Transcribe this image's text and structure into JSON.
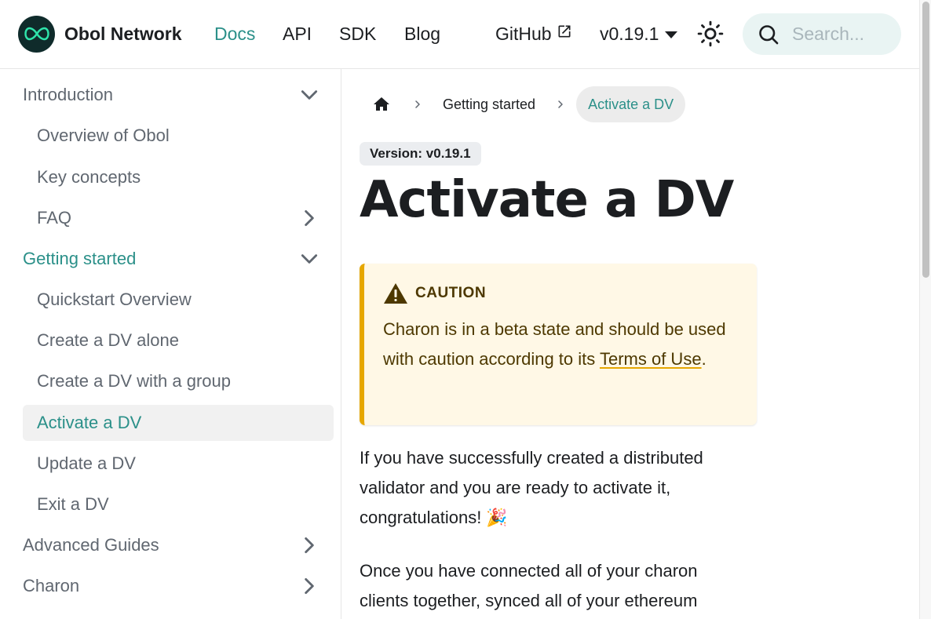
{
  "navbar": {
    "brand": "Obol Network",
    "links": {
      "docs": "Docs",
      "api": "API",
      "sdk": "SDK",
      "blog": "Blog",
      "github": "GitHub"
    },
    "version": "v0.19.1",
    "search_placeholder": "Search...",
    "accent_color": "#2b9089"
  },
  "sidebar": {
    "items": [
      {
        "label": "Introduction",
        "level": 0,
        "state": "expanded"
      },
      {
        "label": "Overview of Obol",
        "level": 1
      },
      {
        "label": "Key concepts",
        "level": 1
      },
      {
        "label": "FAQ",
        "level": 1,
        "state": "collapsed"
      },
      {
        "label": "Getting started",
        "level": 0,
        "state": "expanded",
        "active": true
      },
      {
        "label": "Quickstart Overview",
        "level": 1
      },
      {
        "label": "Create a DV alone",
        "level": 1
      },
      {
        "label": "Create a DV with a group",
        "level": 1
      },
      {
        "label": "Activate a DV",
        "level": 1,
        "current": true
      },
      {
        "label": "Update a DV",
        "level": 1
      },
      {
        "label": "Exit a DV",
        "level": 1
      },
      {
        "label": "Advanced Guides",
        "level": 0,
        "state": "collapsed"
      },
      {
        "label": "Charon",
        "level": 0,
        "state": "collapsed"
      }
    ]
  },
  "breadcrumbs": {
    "items": [
      "Getting started",
      "Activate a DV"
    ]
  },
  "main": {
    "version_badge": "Version: v0.19.1",
    "title": "Activate a DV",
    "caution": {
      "heading": "CAUTION",
      "text_before": "Charon is in a beta state and should be used with caution according to its ",
      "link": "Terms of Use",
      "text_after": "."
    },
    "paragraph1": "If you have successfully created a distributed validator and you are ready to activate it, congratulations! 🎉",
    "paragraph2": "Once you have connected all of your charon clients together, synced all of your ethereum"
  }
}
